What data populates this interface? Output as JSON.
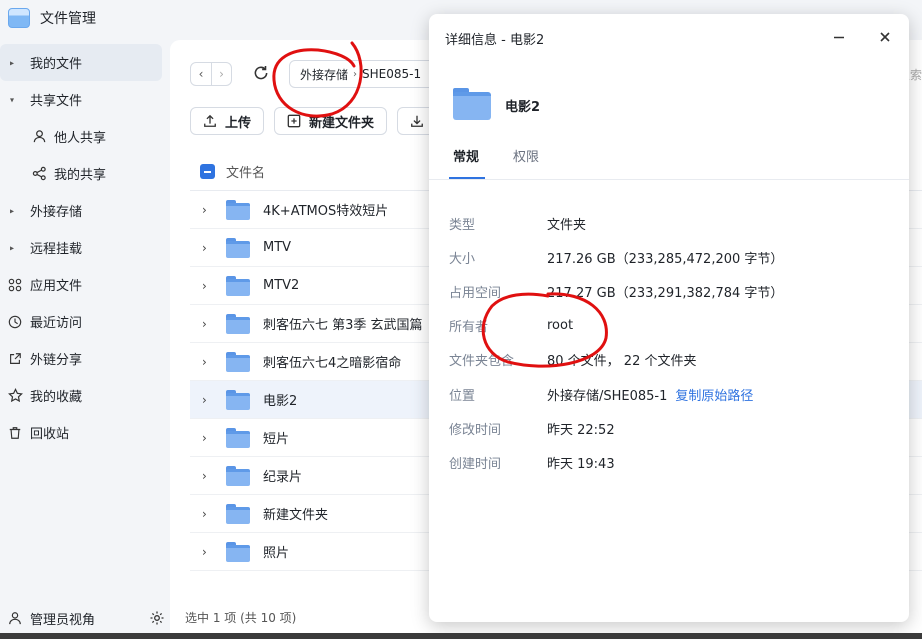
{
  "app": {
    "title": "文件管理"
  },
  "sidebar": {
    "items": [
      {
        "label": "我的文件",
        "caret": "▸",
        "active": true
      },
      {
        "label": "共享文件",
        "caret": "▾"
      },
      {
        "label": "他人共享",
        "icon": "user-icon"
      },
      {
        "label": "我的共享",
        "icon": "share-icon"
      },
      {
        "label": "外接存储",
        "caret": "▸"
      },
      {
        "label": "远程挂载",
        "caret": "▸"
      },
      {
        "label": "应用文件",
        "icon": "apps-icon"
      },
      {
        "label": "最近访问",
        "icon": "clock-icon"
      },
      {
        "label": "外链分享",
        "icon": "link-share-icon"
      },
      {
        "label": "我的收藏",
        "icon": "star-icon"
      },
      {
        "label": "回收站",
        "icon": "trash-icon"
      }
    ],
    "admin_label": "管理员视角"
  },
  "toolbar": {
    "back": "‹",
    "forward": "›",
    "path": [
      "外接存储",
      "SHE085-1"
    ],
    "path_sep": "›",
    "search_stub": "搜索",
    "upload_label": "上传",
    "new_folder_label": "新建文件夹"
  },
  "table": {
    "header_name": "文件名",
    "caret": "›",
    "rows": [
      "4K+ATMOS特效短片",
      "MTV",
      "MTV2",
      "刺客伍六七 第3季 玄武国篇",
      "刺客伍六七4之暗影宿命",
      "电影2",
      "短片",
      "纪录片",
      "新建文件夹",
      "照片"
    ],
    "selected_index": 5
  },
  "status": "选中 1 项 (共 10 项)",
  "dialog": {
    "title": "详细信息 - 电影2",
    "folder_name": "电影2",
    "tabs": [
      "常规",
      "权限"
    ],
    "props": [
      {
        "key": "类型",
        "value": "文件夹"
      },
      {
        "key": "大小",
        "value": "217.26 GB（233,285,472,200 字节）"
      },
      {
        "key": "占用空间",
        "value": "217.27 GB（233,291,382,784 字节）"
      },
      {
        "key": "所有者",
        "value": "root"
      },
      {
        "key": "文件夹包含",
        "value": "80 个文件，  22 个文件夹"
      },
      {
        "key": "位置",
        "value": "外接存储/SHE085-1",
        "link": "复制原始路径"
      },
      {
        "key": "修改时间",
        "value": "昨天 22:52"
      },
      {
        "key": "创建时间",
        "value": "昨天 19:43"
      }
    ]
  },
  "colors": {
    "accent": "#2f73e0",
    "annotation": "#e01010",
    "folder": "#86b5f2"
  }
}
